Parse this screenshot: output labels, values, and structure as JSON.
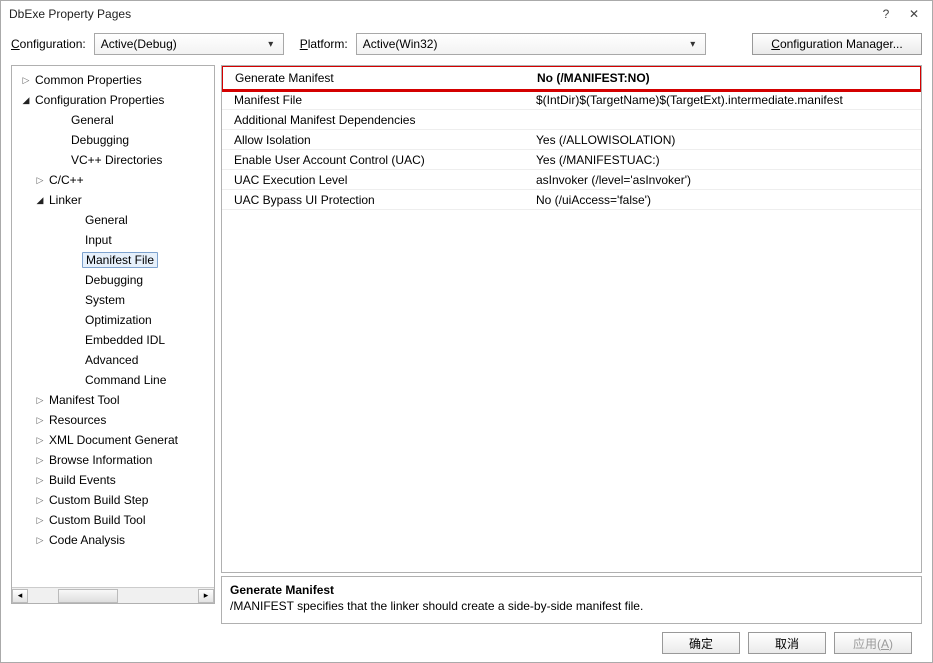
{
  "window": {
    "title": "DbExe Property Pages"
  },
  "toolbar": {
    "configuration_label": "Configuration:",
    "configuration_value": "Active(Debug)",
    "platform_label": "Platform:",
    "platform_value": "Active(Win32)",
    "config_manager": "Configuration Manager..."
  },
  "tree": {
    "items": [
      {
        "label": "Common Properties",
        "depth": 1,
        "arrow": "▷"
      },
      {
        "label": "Configuration Properties",
        "depth": 1,
        "arrow": "◢"
      },
      {
        "label": "General",
        "depth": 3,
        "arrow": ""
      },
      {
        "label": "Debugging",
        "depth": 3,
        "arrow": ""
      },
      {
        "label": "VC++ Directories",
        "depth": 3,
        "arrow": ""
      },
      {
        "label": "C/C++",
        "depth": 2,
        "arrow": "▷"
      },
      {
        "label": "Linker",
        "depth": 2,
        "arrow": "◢"
      },
      {
        "label": "General",
        "depth": 4,
        "arrow": ""
      },
      {
        "label": "Input",
        "depth": 4,
        "arrow": ""
      },
      {
        "label": "Manifest File",
        "depth": 4,
        "arrow": "",
        "selected": true
      },
      {
        "label": "Debugging",
        "depth": 4,
        "arrow": ""
      },
      {
        "label": "System",
        "depth": 4,
        "arrow": ""
      },
      {
        "label": "Optimization",
        "depth": 4,
        "arrow": ""
      },
      {
        "label": "Embedded IDL",
        "depth": 4,
        "arrow": ""
      },
      {
        "label": "Advanced",
        "depth": 4,
        "arrow": ""
      },
      {
        "label": "Command Line",
        "depth": 4,
        "arrow": ""
      },
      {
        "label": "Manifest Tool",
        "depth": 2,
        "arrow": "▷"
      },
      {
        "label": "Resources",
        "depth": 2,
        "arrow": "▷"
      },
      {
        "label": "XML Document Generat",
        "depth": 2,
        "arrow": "▷"
      },
      {
        "label": "Browse Information",
        "depth": 2,
        "arrow": "▷"
      },
      {
        "label": "Build Events",
        "depth": 2,
        "arrow": "▷"
      },
      {
        "label": "Custom Build Step",
        "depth": 2,
        "arrow": "▷"
      },
      {
        "label": "Custom Build Tool",
        "depth": 2,
        "arrow": "▷"
      },
      {
        "label": "Code Analysis",
        "depth": 2,
        "arrow": "▷"
      }
    ]
  },
  "properties": [
    {
      "name": "Generate Manifest",
      "value": "No (/MANIFEST:NO)",
      "highlight": true
    },
    {
      "name": "Manifest File",
      "value": "$(IntDir)$(TargetName)$(TargetExt).intermediate.manifest"
    },
    {
      "name": "Additional Manifest Dependencies",
      "value": ""
    },
    {
      "name": "Allow Isolation",
      "value": "Yes (/ALLOWISOLATION)"
    },
    {
      "name": "Enable User Account Control (UAC)",
      "value": "Yes (/MANIFESTUAC:)"
    },
    {
      "name": "UAC Execution Level",
      "value": "asInvoker (/level='asInvoker')"
    },
    {
      "name": "UAC Bypass UI Protection",
      "value": "No (/uiAccess='false')"
    }
  ],
  "description": {
    "title": "Generate Manifest",
    "text": "/MANIFEST specifies that the linker should create a side-by-side manifest file."
  },
  "buttons": {
    "ok": "确定",
    "cancel": "取消",
    "apply": "应用(A)"
  }
}
